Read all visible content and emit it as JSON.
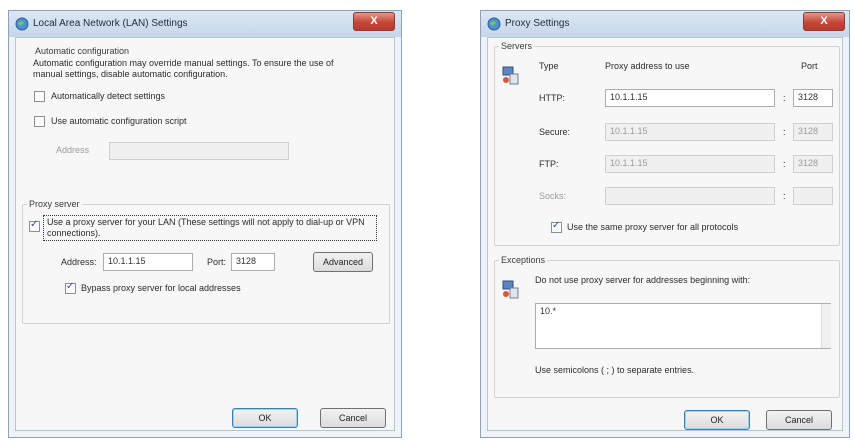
{
  "lan": {
    "title": "Local Area Network (LAN) Settings",
    "close_label": "X",
    "auto_config": {
      "group_title": "Automatic configuration",
      "description": "Automatic configuration may override manual settings.  To ensure the use of manual settings, disable automatic configuration.",
      "auto_detect_label": "Automatically detect settings",
      "auto_detect_checked": false,
      "use_script_label": "Use automatic configuration script",
      "use_script_checked": false,
      "address_label": "Address",
      "address_value": ""
    },
    "proxy": {
      "group_title": "Proxy server",
      "use_proxy_label": "Use a proxy server for your LAN (These settings will not apply to dial-up or VPN connections).",
      "use_proxy_checked": true,
      "address_label": "Address:",
      "address_value": "10.1.1.15",
      "port_label": "Port:",
      "port_value": "3128",
      "advanced_label": "Advanced",
      "bypass_label": "Bypass proxy server for local addresses",
      "bypass_checked": true
    },
    "ok_label": "OK",
    "cancel_label": "Cancel"
  },
  "proxy_settings": {
    "title": "Proxy Settings",
    "close_label": "X",
    "servers": {
      "group_title": "Servers",
      "col_type": "Type",
      "col_address": "Proxy address to use",
      "col_port": "Port",
      "rows": [
        {
          "type": "HTTP:",
          "address": "10.1.1.15",
          "port": "3128",
          "enabled": true
        },
        {
          "type": "Secure:",
          "address": "10.1.1.15",
          "port": "3128",
          "enabled": false
        },
        {
          "type": "FTP:",
          "address": "10.1.1.15",
          "port": "3128",
          "enabled": false
        },
        {
          "type": "Socks:",
          "address": "",
          "port": "",
          "enabled": false
        }
      ],
      "same_proxy_label": "Use the same proxy server for all protocols",
      "same_proxy_checked": true
    },
    "exceptions": {
      "group_title": "Exceptions",
      "description": "Do not use proxy server for addresses beginning with:",
      "value": "10.*",
      "hint": "Use semicolons ( ; ) to separate entries."
    },
    "ok_label": "OK",
    "cancel_label": "Cancel"
  }
}
